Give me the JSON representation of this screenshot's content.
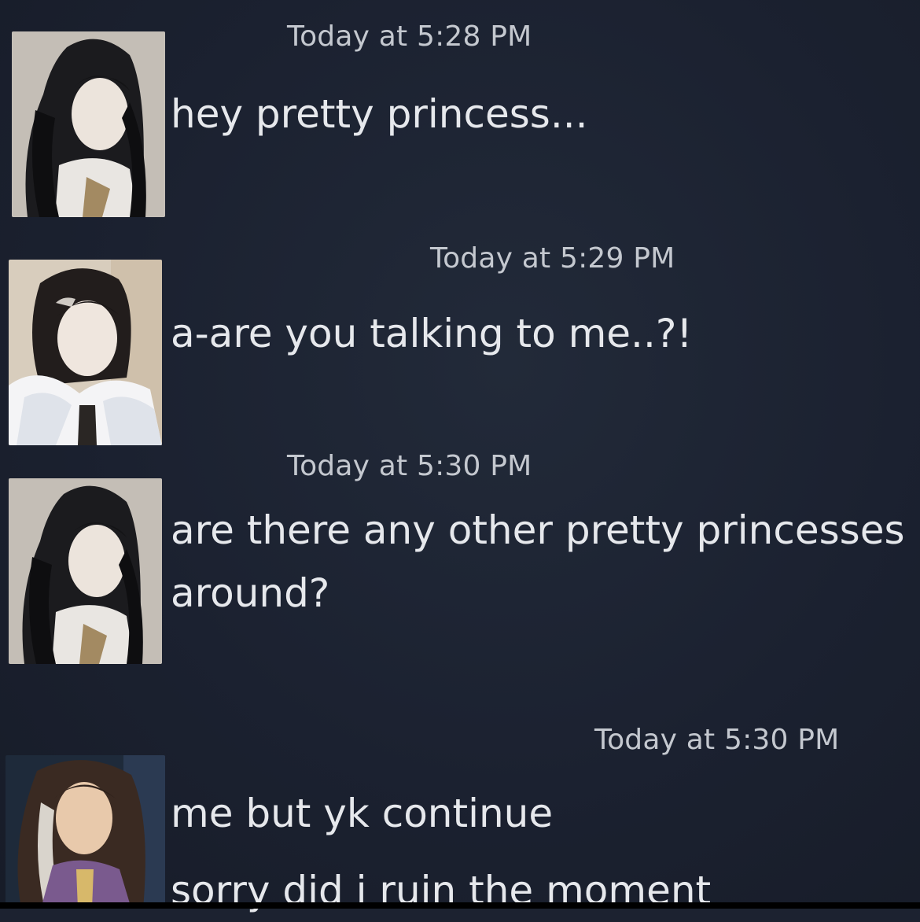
{
  "messages": [
    {
      "avatar_icon": "long-black-hair-avatar-icon",
      "timestamp": "Today at 5:28 PM",
      "lines": [
        "hey pretty princess..."
      ]
    },
    {
      "avatar_icon": "fur-collar-avatar-icon",
      "timestamp": "Today at 5:29 PM",
      "lines": [
        "a-are you talking to me..?!"
      ]
    },
    {
      "avatar_icon": "long-black-hair-avatar-icon",
      "timestamp": "Today at 5:30 PM",
      "lines": [
        "are there any other pretty princesses",
        "around?"
      ]
    },
    {
      "avatar_icon": "brown-hair-avatar-icon",
      "timestamp": "Today at 5:30 PM",
      "lines": [
        "me but yk continue",
        "sorry did i ruin the moment"
      ]
    }
  ],
  "colors": {
    "background": "#1c2230",
    "timestamp": "#c4c8cf",
    "text": "#e6e8ec"
  }
}
